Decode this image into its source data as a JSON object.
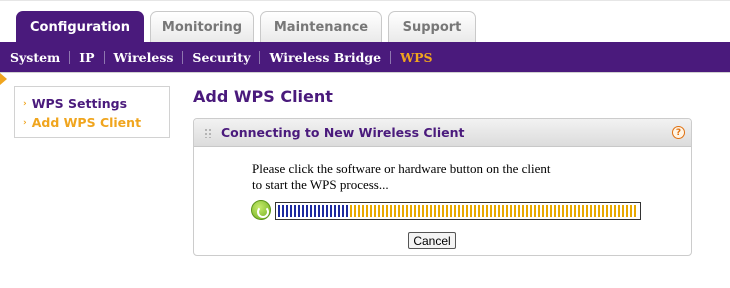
{
  "tabs": [
    {
      "label": "Configuration",
      "active": true
    },
    {
      "label": "Monitoring",
      "active": false
    },
    {
      "label": "Maintenance",
      "active": false
    },
    {
      "label": "Support",
      "active": false
    }
  ],
  "subnav": {
    "items": [
      "System",
      "IP",
      "Wireless",
      "Security",
      "Wireless Bridge",
      "WPS"
    ],
    "active": "WPS"
  },
  "sidebar": {
    "items": [
      {
        "label": "WPS Settings",
        "active": false
      },
      {
        "label": "Add WPS Client",
        "active": true
      }
    ]
  },
  "page": {
    "title": "Add WPS Client"
  },
  "panel": {
    "title": "Connecting to New Wireless Client",
    "help_symbol": "?",
    "message_line1": "Please click the software or hardware button on the client",
    "message_line2": "to start the WPS process...",
    "progress_percent": 20,
    "cancel_label": "Cancel"
  },
  "colors": {
    "brand_purple": "#4a1a7c",
    "accent_orange": "#f0a51e",
    "progress_done": "#1c2aa0",
    "progress_remaining": "#e8a800"
  },
  "icons": {
    "wps": "wps-icon",
    "help": "help-icon",
    "marker": "arrow-marker-icon"
  }
}
